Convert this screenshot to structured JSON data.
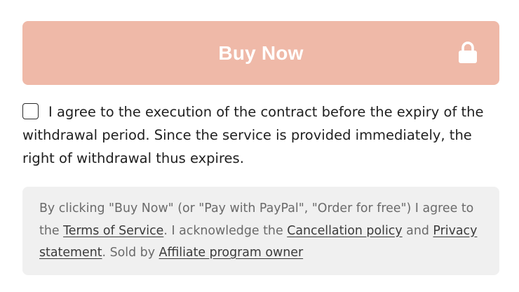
{
  "buy_button": {
    "label": "Buy Now",
    "background_color": "#efb9a8",
    "icon": "lock-icon"
  },
  "consent": {
    "checked": false,
    "text": "I agree to the execution of the contract before the expiry of the withdrawal period. Since the service is provided immediately, the right of withdrawal thus expires."
  },
  "legal": {
    "prefix": "By clicking \"Buy Now\" (or \"Pay with PayPal\", \"Order for free\") I agree to the ",
    "terms_link": "Terms of Service",
    "mid1": ". I acknowledge the ",
    "cancellation_link": "Cancellation policy",
    "mid2": " and ",
    "privacy_link": "Privacy statement",
    "mid3": ". Sold by ",
    "seller_link": "Affiliate program owner",
    "background_color": "#f0f0f0"
  }
}
